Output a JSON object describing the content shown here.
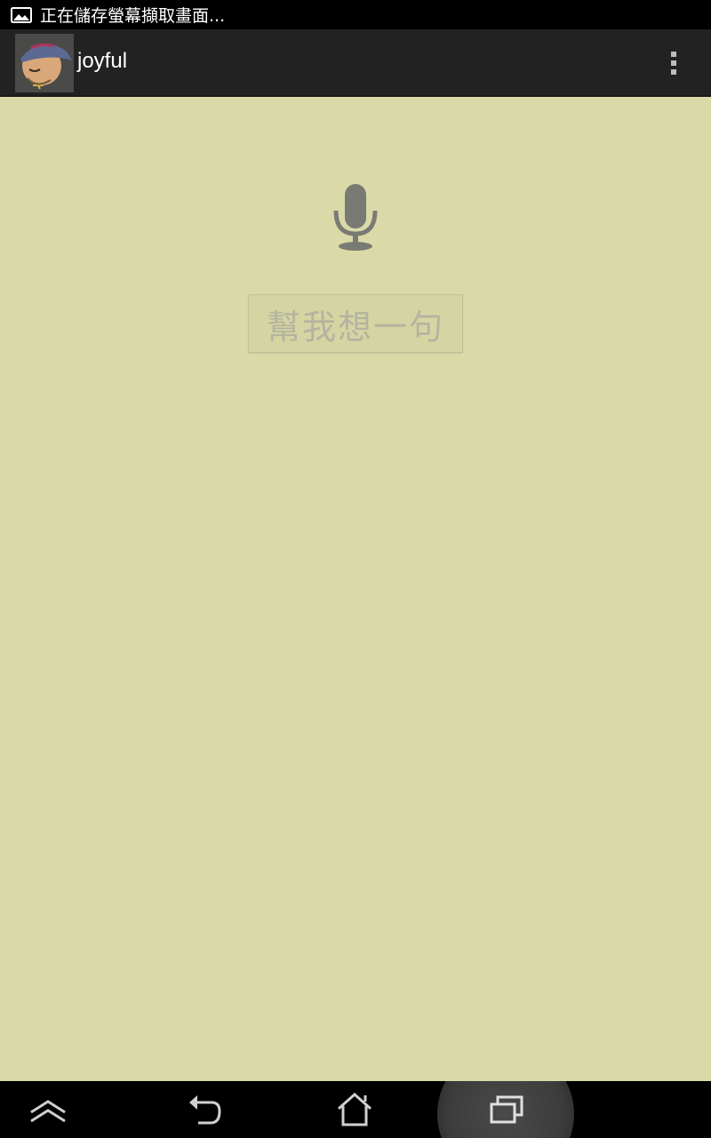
{
  "status_bar": {
    "notification_icon": "screenshot-image-icon",
    "text": "正在儲存螢幕擷取畫面..."
  },
  "action_bar": {
    "app_icon": "app-avatar-icon",
    "title": "joyful",
    "overflow_icon": "overflow-menu-icon"
  },
  "main": {
    "mic_icon": "microphone-icon",
    "suggest_button_label": "幫我想一句"
  },
  "nav_bar": {
    "items": [
      {
        "icon": "hide-keyboard-icon"
      },
      {
        "icon": "back-icon"
      },
      {
        "icon": "home-icon"
      },
      {
        "icon": "recent-apps-icon"
      }
    ]
  },
  "colors": {
    "content_background": "#dadaa9",
    "action_bar": "#222222",
    "status_bar": "#000000"
  }
}
